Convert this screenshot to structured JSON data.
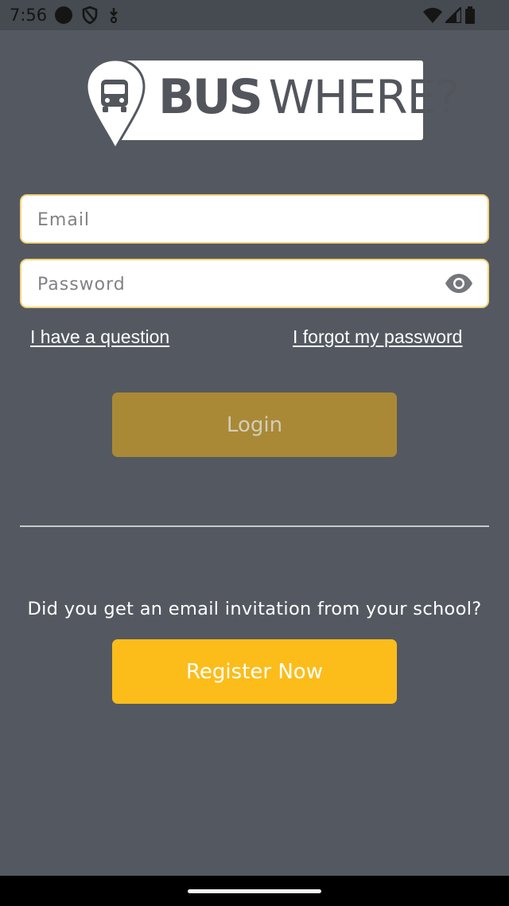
{
  "status_bar": {
    "time": "7:56",
    "left_icons": [
      "dot-icon",
      "shield-icon",
      "download-icon"
    ],
    "right_icons": [
      "wifi-icon",
      "signal-icon",
      "battery-icon"
    ]
  },
  "logo": {
    "word_bold": "BUS",
    "word_light": "WHERE?",
    "icon": "bus-pin-icon"
  },
  "form": {
    "email": {
      "placeholder": "Email",
      "value": ""
    },
    "password": {
      "placeholder": "Password",
      "value": "",
      "toggle_icon": "eye-icon"
    },
    "question_link": "I have a question",
    "forgot_link": "I forgot my password",
    "login_label": "Login"
  },
  "register": {
    "prompt": "Did you get an email invitation from your school?",
    "button_label": "Register Now"
  },
  "colors": {
    "background": "#545961",
    "accent": "#fcbd1b",
    "login_disabled": "#a98936",
    "field_border": "#f6d378"
  }
}
